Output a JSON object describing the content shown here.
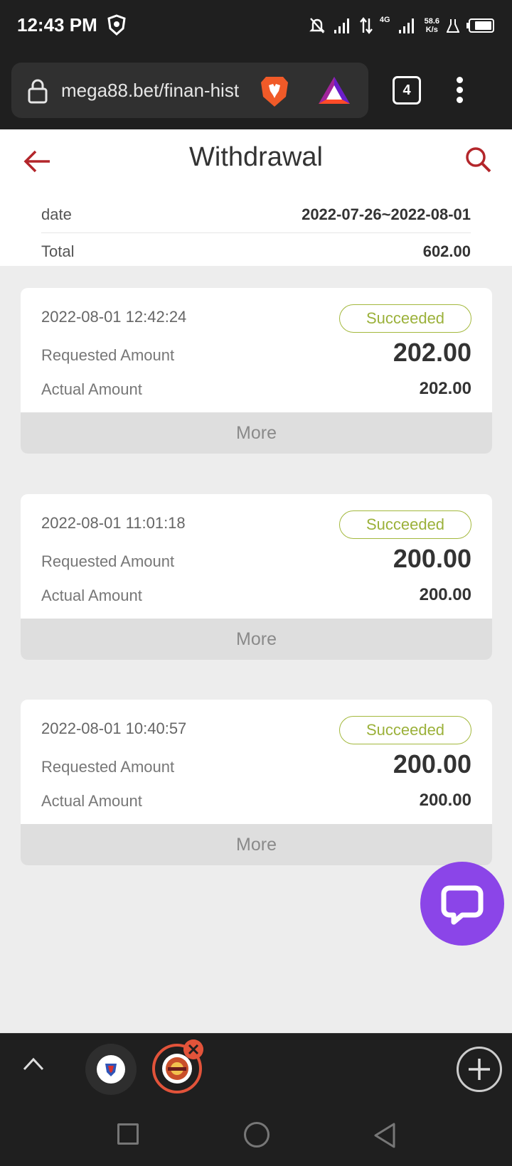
{
  "status_bar": {
    "time": "12:43 PM",
    "network": "4G",
    "speed_value": "58.6",
    "speed_unit": "K/s"
  },
  "browser": {
    "url": "mega88.bet/finan-hist",
    "tab_count": "4"
  },
  "page": {
    "title": "Withdrawal",
    "date_label": "date",
    "date_range": "2022-07-26~2022-08-01",
    "total_label": "Total",
    "total_value": "602.00"
  },
  "records": [
    {
      "time": "2022-08-01 12:42:24",
      "status": "Succeeded",
      "requested_label": "Requested Amount",
      "requested_amount": "202.00",
      "actual_label": "Actual Amount",
      "actual_amount": "202.00",
      "more_label": "More"
    },
    {
      "time": "2022-08-01 11:01:18",
      "status": "Succeeded",
      "requested_label": "Requested Amount",
      "requested_amount": "200.00",
      "actual_label": "Actual Amount",
      "actual_amount": "200.00",
      "more_label": "More"
    },
    {
      "time": "2022-08-01 10:40:57",
      "status": "Succeeded",
      "requested_label": "Requested Amount",
      "requested_amount": "200.00",
      "actual_label": "Actual Amount",
      "actual_amount": "200.00",
      "more_label": "More"
    }
  ],
  "colors": {
    "accent_red": "#b3262b",
    "success_green": "#9bb13a",
    "chat_purple": "#8b45e8",
    "tab_active_ring": "#e2533a"
  },
  "icons": {
    "back": "back-arrow-icon",
    "search": "search-icon",
    "chat": "chat-bubble-icon",
    "lock": "lock-icon",
    "brave": "brave-lion-icon",
    "rewards": "brave-rewards-icon"
  }
}
